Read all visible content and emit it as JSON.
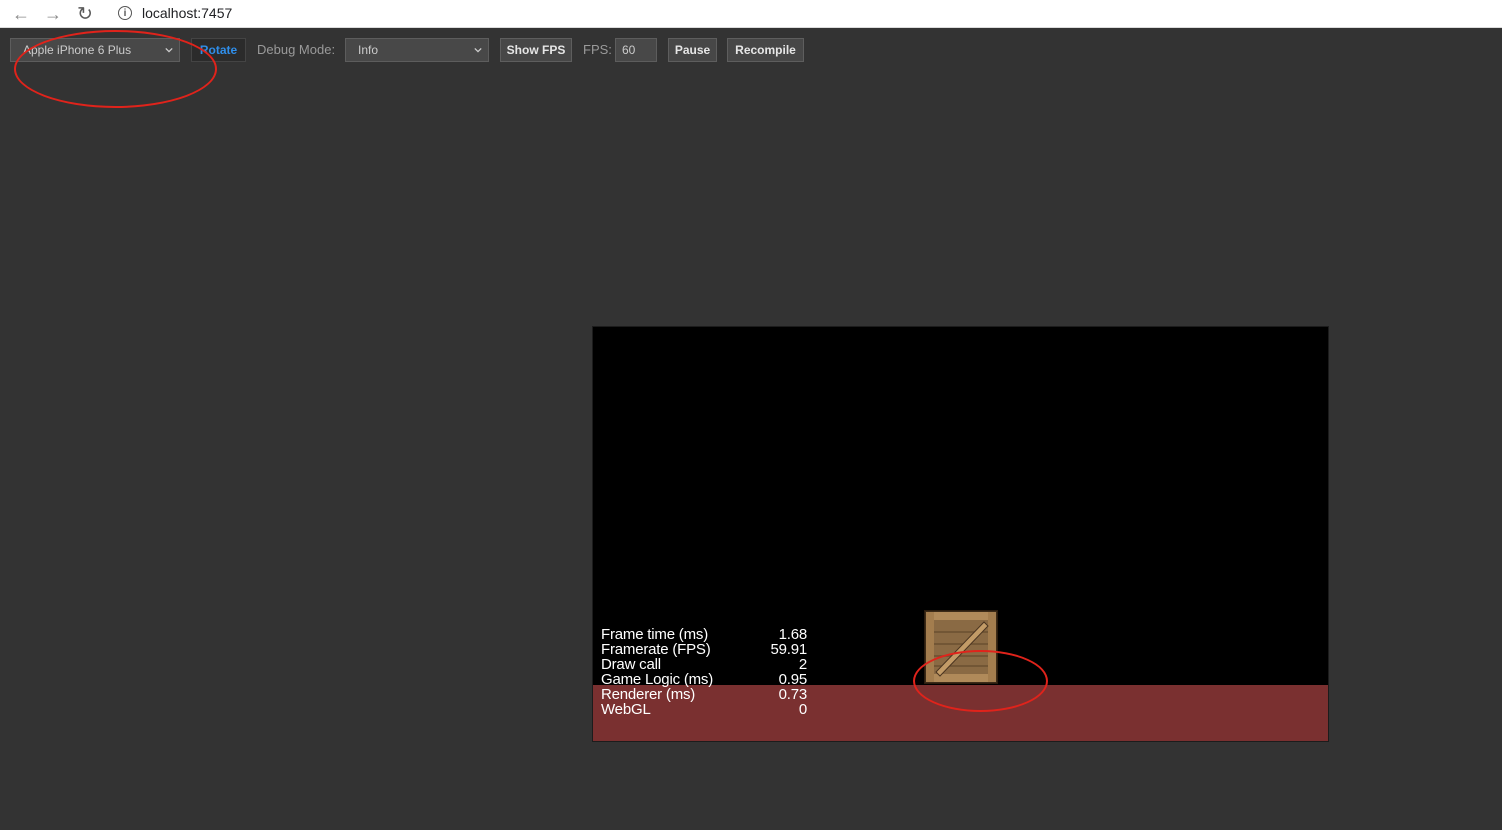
{
  "browser": {
    "url": "localhost:7457"
  },
  "toolbar": {
    "device_select": {
      "value": "Apple iPhone 6 Plus"
    },
    "rotate_label": "Rotate",
    "debug_mode_label": "Debug Mode:",
    "debug_mode_select": {
      "value": "Info"
    },
    "show_fps_label": "Show FPS",
    "fps_label": "FPS:",
    "fps_value": "60",
    "pause_label": "Pause",
    "recompile_label": "Recompile"
  },
  "stats": [
    {
      "label": "Frame time (ms)",
      "value": "1.68"
    },
    {
      "label": "Framerate (FPS)",
      "value": "59.91"
    },
    {
      "label": "Draw call",
      "value": "2"
    },
    {
      "label": "Game Logic (ms)",
      "value": "0.95"
    },
    {
      "label": "Renderer (ms)",
      "value": "0.73"
    },
    {
      "label": "WebGL",
      "value": "0"
    }
  ],
  "colors": {
    "page_background": "#333333",
    "canvas_background": "#000000",
    "ground": "#7a3030",
    "rotate_accent": "#2f8eea",
    "annotation": "#e0231b"
  },
  "icons": {
    "back": "arrow-left-icon",
    "forward": "arrow-right-icon",
    "reload": "reload-icon",
    "site_info": "info-icon",
    "dropdown": "chevron-down-icon"
  }
}
